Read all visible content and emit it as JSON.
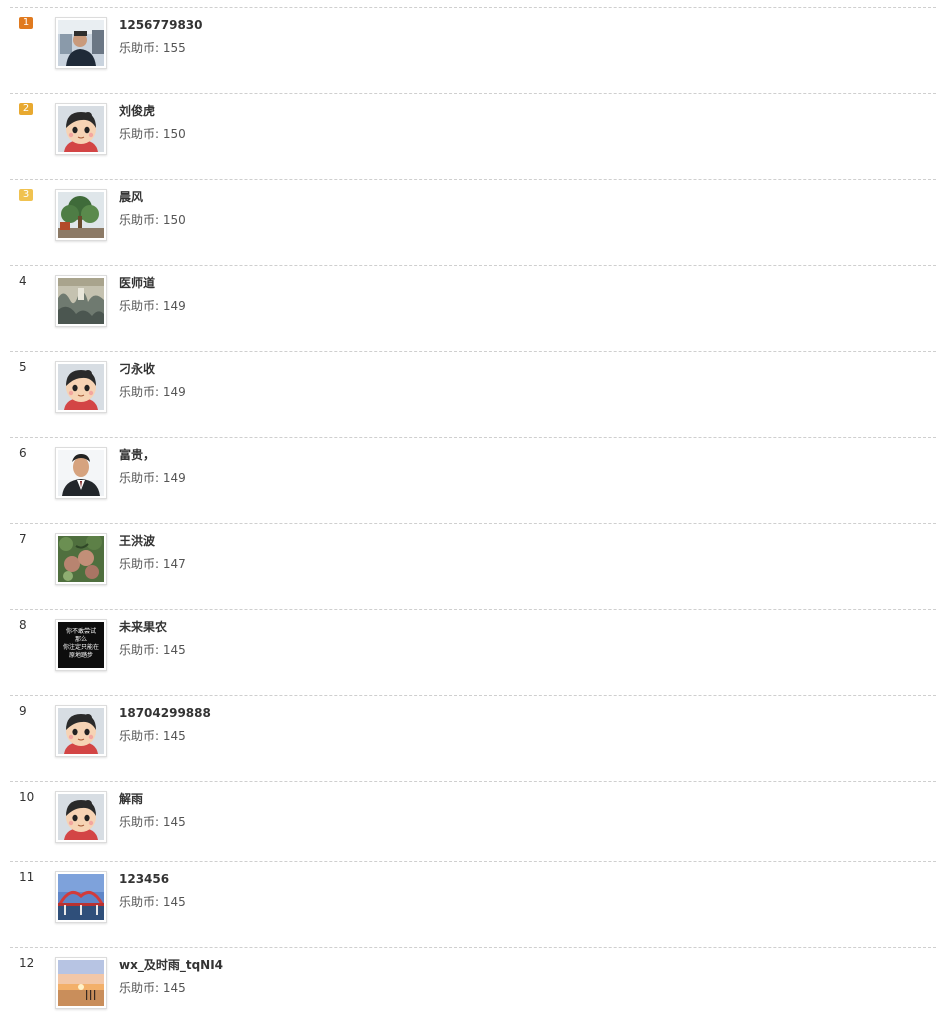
{
  "rows": [
    {
      "rank": "1",
      "badge_color": "#e07a1f",
      "name": "1256779830",
      "coins_label": "乐助币: 155",
      "avatar_icon": "avatar-photo-man-car"
    },
    {
      "rank": "2",
      "badge_color": "#e8a930",
      "name": "刘俊虎",
      "coins_label": "乐助币: 150",
      "avatar_icon": "avatar-default-cartoon"
    },
    {
      "rank": "3",
      "badge_color": "#f0c250",
      "name": "晨风",
      "coins_label": "乐助币: 150",
      "avatar_icon": "avatar-photo-tree"
    },
    {
      "rank": "4",
      "badge_color": "",
      "name": "医师道",
      "coins_label": "乐助币: 149",
      "avatar_icon": "avatar-landscape-painting"
    },
    {
      "rank": "5",
      "badge_color": "",
      "name": "刁永收",
      "coins_label": "乐助币: 149",
      "avatar_icon": "avatar-default-cartoon"
    },
    {
      "rank": "6",
      "badge_color": "",
      "name": "富贵，",
      "coins_label": "乐助币: 149",
      "avatar_icon": "avatar-photo-portrait"
    },
    {
      "rank": "7",
      "badge_color": "",
      "name": "王洪波",
      "coins_label": "乐助币: 147",
      "avatar_icon": "avatar-photo-fruit"
    },
    {
      "rank": "8",
      "badge_color": "",
      "name": "未来果农",
      "coins_label": "乐助币: 145",
      "avatar_icon": "avatar-text-black"
    },
    {
      "rank": "9",
      "badge_color": "",
      "name": "18704299888",
      "coins_label": "乐助币: 145",
      "avatar_icon": "avatar-default-cartoon"
    },
    {
      "rank": "10",
      "badge_color": "",
      "name": "解雨",
      "coins_label": "乐助币: 145",
      "avatar_icon": "avatar-default-cartoon"
    },
    {
      "rank": "11",
      "badge_color": "",
      "name": "123456",
      "coins_label": "乐助币: 145",
      "avatar_icon": "avatar-photo-bridge"
    },
    {
      "rank": "12",
      "badge_color": "",
      "name": "wx_及时雨_tqNI4",
      "coins_label": "乐助币: 145",
      "avatar_icon": "avatar-photo-sunset"
    }
  ],
  "avatar_text_lines": [
    "你不敢尝试",
    "那么",
    "你注定只能在",
    "原地踏步"
  ]
}
